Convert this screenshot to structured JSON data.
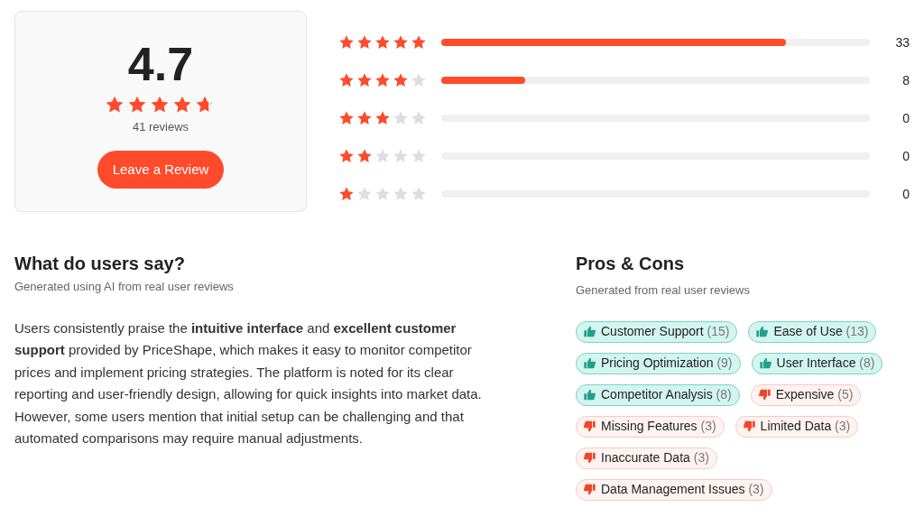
{
  "summary": {
    "score": "4.7",
    "stars": 4.7,
    "review_count": "41 reviews",
    "button": "Leave a Review"
  },
  "distribution": [
    {
      "stars": 5,
      "level": 0.805,
      "count": "33"
    },
    {
      "stars": 4,
      "level": 0.195,
      "count": "8"
    },
    {
      "stars": 3,
      "level": 0,
      "count": "0"
    },
    {
      "stars": 2,
      "level": 0,
      "count": "0"
    },
    {
      "stars": 1,
      "level": 0,
      "count": "0"
    }
  ],
  "users_say": {
    "title": "What do users say?",
    "subtitle": "Generated using AI from real user reviews",
    "text": "Users consistently praise the **intuitive interface** and **excellent customer support** provided by PriceShape, which makes it easy to monitor competitor prices and implement pricing strategies. The platform is noted for its clear reporting and user-friendly design, allowing for quick insights into market data. However, some users mention that initial setup can be challenging and that automated comparisons may require manual adjustments."
  },
  "pros_cons": {
    "title": "Pros & Cons",
    "subtitle": "Generated from real user reviews",
    "tags": [
      {
        "kind": "pro",
        "label": "Customer Support",
        "count": "(15)"
      },
      {
        "kind": "pro",
        "label": "Ease of Use",
        "count": "(13)"
      },
      {
        "kind": "pro",
        "label": "Pricing Optimization",
        "count": "(9)"
      },
      {
        "kind": "pro",
        "label": "User Interface",
        "count": "(8)"
      },
      {
        "kind": "pro",
        "label": "Competitor Analysis",
        "count": "(8)"
      },
      {
        "kind": "con",
        "label": "Expensive",
        "count": "(5)"
      },
      {
        "kind": "con",
        "label": "Missing Features",
        "count": "(3)"
      },
      {
        "kind": "con",
        "label": "Limited Data",
        "count": "(3)"
      },
      {
        "kind": "con",
        "label": "Inaccurate Data",
        "count": "(3)"
      },
      {
        "kind": "con",
        "label": "Data Management Issues",
        "count": "(3)"
      }
    ]
  }
}
